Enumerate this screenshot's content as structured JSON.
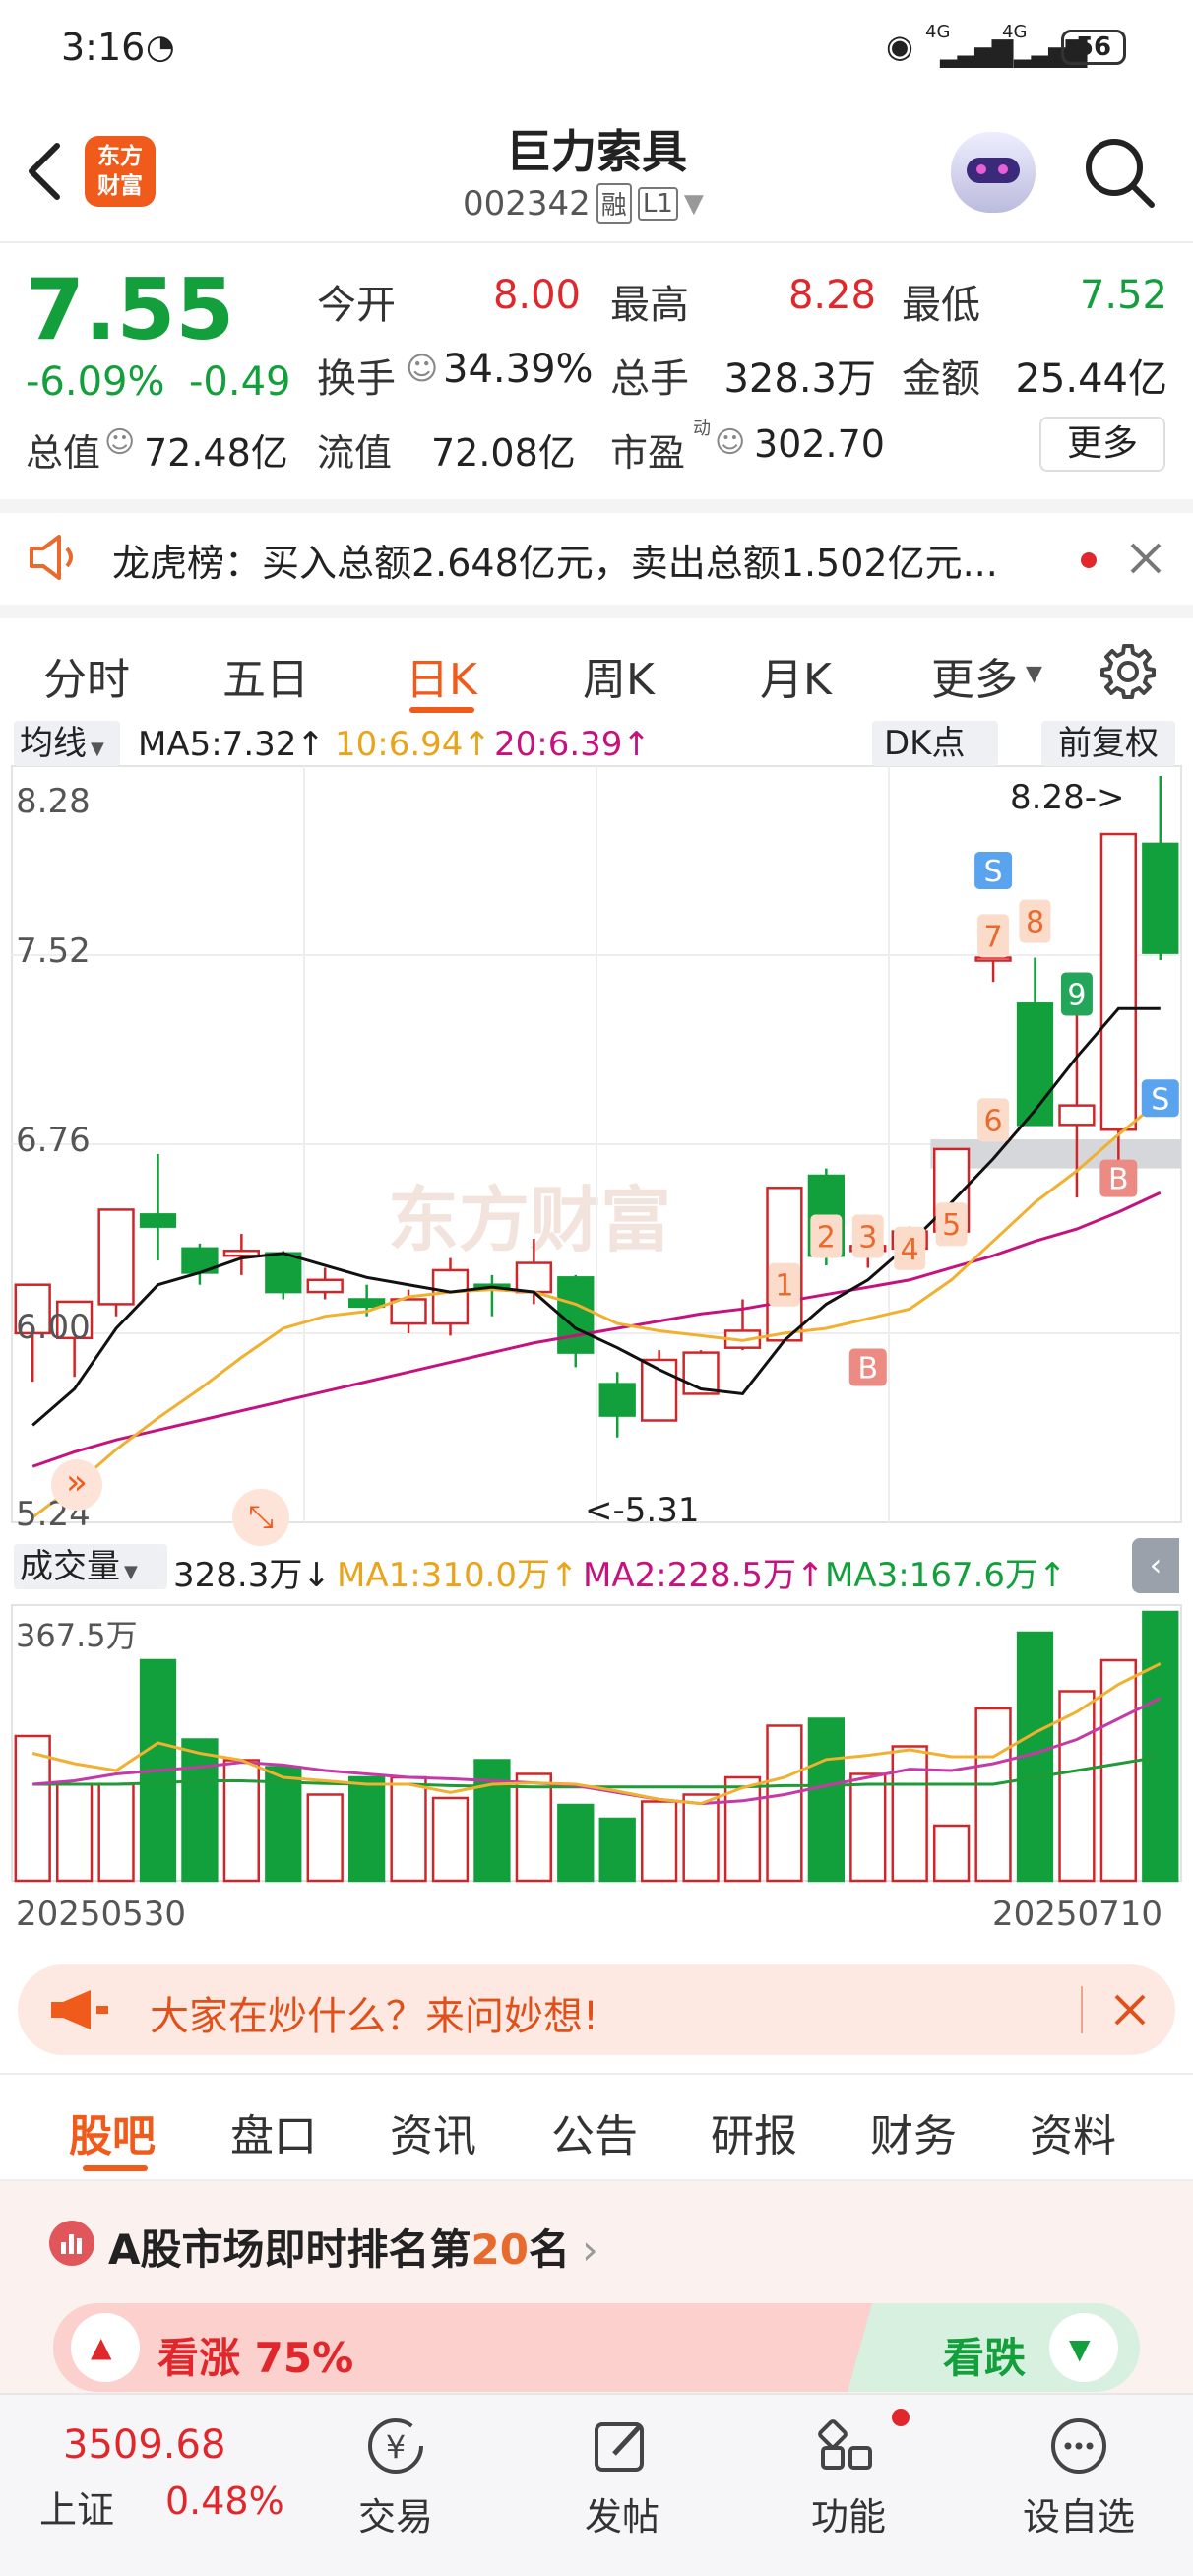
{
  "status": {
    "time": "3:16",
    "battery": "56",
    "net1": "4G",
    "net2": "4G"
  },
  "header": {
    "title": "巨力索具",
    "code": "002342",
    "tag1": "融",
    "tag2": "L1",
    "logo_line1": "东方",
    "logo_line2": "财富"
  },
  "quote": {
    "price": "7.55",
    "change_pct": "-6.09%",
    "change": "-0.49",
    "open_label": "今开",
    "open": "8.00",
    "high_label": "最高",
    "high": "8.28",
    "low_label": "最低",
    "low": "7.52",
    "turnover_label": "换手",
    "turnover": "34.39%",
    "volume_label": "总手",
    "volume": "328.3万",
    "amount_label": "金额",
    "amount": "25.44亿",
    "mktcap_label": "总值",
    "mktcap": "72.48亿",
    "float_label": "流值",
    "float": "72.08亿",
    "pe_label": "市盈",
    "pe_sup": "动",
    "pe": "302.70",
    "more": "更多"
  },
  "notice": {
    "text": "龙虎榜：买入总额2.648亿元，卖出总额1.502亿元..."
  },
  "tabs": [
    "分时",
    "五日",
    "日K",
    "周K",
    "月K",
    "更多"
  ],
  "active_tab": "日K",
  "ma_bar": {
    "select": "均线",
    "ma5": "MA5:7.32↑",
    "ma10": "10:6.94↑",
    "ma20": "20:6.39↑",
    "dk": "DK点",
    "adj": "前复权"
  },
  "price_axis": [
    "8.28",
    "7.52",
    "6.76",
    "6.00",
    "5.24"
  ],
  "annotations": {
    "high": "8.28->",
    "low": "<-5.31",
    "watermark": "东方财富"
  },
  "vol_bar": {
    "select": "成交量",
    "vol": "328.3万↓",
    "ma1": "MA1:310.0万↑",
    "ma2": "MA2:228.5万↑",
    "ma3": "MA3:167.6万↑",
    "max": "367.5万"
  },
  "date_range": {
    "start": "20250530",
    "end": "20250710"
  },
  "chart_data": {
    "type": "candlestick",
    "ylim": [
      5.24,
      8.28
    ],
    "candles": [
      {
        "o": 5.98,
        "c": 6.18,
        "h": 6.18,
        "l": 5.78
      },
      {
        "o": 5.96,
        "c": 6.11,
        "h": 6.11,
        "l": 5.8
      },
      {
        "o": 6.1,
        "c": 6.49,
        "h": 6.49,
        "l": 6.05
      },
      {
        "o": 6.47,
        "c": 6.42,
        "h": 6.72,
        "l": 6.28
      },
      {
        "o": 6.33,
        "c": 6.23,
        "h": 6.35,
        "l": 6.18
      },
      {
        "o": 6.3,
        "c": 6.32,
        "h": 6.39,
        "l": 6.22
      },
      {
        "o": 6.31,
        "c": 6.15,
        "h": 6.32,
        "l": 6.12
      },
      {
        "o": 6.15,
        "c": 6.2,
        "h": 6.25,
        "l": 6.12
      },
      {
        "o": 6.12,
        "c": 6.09,
        "h": 6.18,
        "l": 6.05
      },
      {
        "o": 6.02,
        "c": 6.12,
        "h": 6.16,
        "l": 5.98
      },
      {
        "o": 6.02,
        "c": 6.24,
        "h": 6.29,
        "l": 5.97
      },
      {
        "o": 6.18,
        "c": 6.16,
        "h": 6.22,
        "l": 6.05
      },
      {
        "o": 6.15,
        "c": 6.27,
        "h": 6.37,
        "l": 6.1
      },
      {
        "o": 6.21,
        "c": 5.9,
        "h": 6.22,
        "l": 5.84
      },
      {
        "o": 5.77,
        "c": 5.64,
        "h": 5.82,
        "l": 5.55
      },
      {
        "o": 5.62,
        "c": 5.87,
        "h": 5.91,
        "l": 5.62
      },
      {
        "o": 5.73,
        "c": 5.9,
        "h": 5.91,
        "l": 5.73
      },
      {
        "o": 5.92,
        "c": 5.99,
        "h": 6.12,
        "l": 5.91
      },
      {
        "o": 5.95,
        "c": 6.58,
        "h": 6.58,
        "l": 5.95
      },
      {
        "o": 6.63,
        "c": 6.3,
        "h": 6.66,
        "l": 6.26
      },
      {
        "o": 6.32,
        "c": 6.34,
        "h": 6.38,
        "l": 6.25
      },
      {
        "o": 6.33,
        "c": 6.4,
        "h": 6.42,
        "l": 6.33
      },
      {
        "o": 6.4,
        "c": 6.74,
        "h": 6.74,
        "l": 6.4
      },
      {
        "o": 7.52,
        "c": 7.53,
        "h": 7.66,
        "l": 7.43
      },
      {
        "o": 7.34,
        "c": 6.84,
        "h": 7.53,
        "l": 6.84
      },
      {
        "o": 6.84,
        "c": 6.92,
        "h": 7.34,
        "l": 6.54
      },
      {
        "o": 6.82,
        "c": 8.04,
        "h": 8.04,
        "l": 6.66
      },
      {
        "o": 8.0,
        "c": 7.55,
        "h": 8.28,
        "l": 7.52
      }
    ],
    "ma5": [
      5.6,
      5.75,
      6.0,
      6.18,
      6.23,
      6.29,
      6.31,
      6.26,
      6.21,
      6.18,
      6.15,
      6.17,
      6.15,
      6.0,
      5.92,
      5.83,
      5.75,
      5.73,
      5.95,
      6.1,
      6.2,
      6.35,
      6.52,
      6.7,
      6.9,
      7.12,
      7.32,
      7.32
    ],
    "ma10": [
      5.22,
      5.35,
      5.5,
      5.63,
      5.75,
      5.88,
      6.0,
      6.05,
      6.07,
      6.13,
      6.15,
      6.16,
      6.15,
      6.1,
      6.02,
      5.99,
      5.97,
      5.95,
      5.98,
      6.0,
      6.04,
      6.08,
      6.2,
      6.36,
      6.52,
      6.65,
      6.8,
      6.94
    ],
    "ma20": [
      5.43,
      5.49,
      5.54,
      5.58,
      5.62,
      5.66,
      5.7,
      5.74,
      5.78,
      5.82,
      5.86,
      5.9,
      5.94,
      5.97,
      6.0,
      6.03,
      6.06,
      6.08,
      6.11,
      6.14,
      6.17,
      6.2,
      6.25,
      6.3,
      6.36,
      6.41,
      6.48,
      6.56
    ],
    "volumes": [
      210,
      140,
      140,
      320,
      205,
      175,
      165,
      125,
      150,
      150,
      120,
      175,
      155,
      110,
      90,
      115,
      125,
      150,
      225,
      235,
      155,
      195,
      80,
      250,
      360,
      275,
      320,
      390
    ],
    "vol_ylim": [
      0,
      400
    ],
    "vol_ma1": [
      185,
      170,
      160,
      200,
      185,
      175,
      150,
      145,
      140,
      140,
      128,
      140,
      142,
      140,
      130,
      118,
      112,
      135,
      150,
      176,
      182,
      190,
      180,
      180,
      215,
      245,
      285,
      315
    ],
    "vol_ma2": [
      140,
      145,
      155,
      160,
      165,
      172,
      168,
      160,
      155,
      150,
      148,
      145,
      142,
      138,
      128,
      118,
      112,
      116,
      125,
      138,
      150,
      162,
      160,
      170,
      185,
      205,
      235,
      265
    ],
    "vol_ma3": [
      140,
      140,
      140,
      142,
      145,
      145,
      143,
      141,
      140,
      140,
      138,
      137,
      136,
      136,
      136,
      136,
      136,
      136,
      138,
      138,
      140,
      140,
      140,
      140,
      150,
      160,
      170,
      180
    ],
    "signals": [
      {
        "i": 18,
        "label": "1",
        "kind": "num"
      },
      {
        "i": 19,
        "label": "2",
        "kind": "num"
      },
      {
        "i": 20,
        "label": "3",
        "kind": "num"
      },
      {
        "i": 21,
        "label": "4",
        "kind": "num"
      },
      {
        "i": 22,
        "label": "5",
        "kind": "num"
      },
      {
        "i": 23,
        "label": "6",
        "kind": "num"
      },
      {
        "i": 23,
        "label": "7",
        "kind": "num"
      },
      {
        "i": 24,
        "label": "8",
        "kind": "num"
      },
      {
        "i": 25,
        "label": "9",
        "kind": "gnum"
      },
      {
        "i": 20,
        "label": "B",
        "kind": "buy"
      },
      {
        "i": 26,
        "label": "B",
        "kind": "buy"
      },
      {
        "i": 23,
        "label": "S",
        "kind": "sell"
      },
      {
        "i": 27,
        "label": "S",
        "kind": "sell"
      }
    ]
  },
  "banner": {
    "text": "大家在炒什么？来问妙想!"
  },
  "subtabs": [
    "股吧",
    "盘口",
    "资讯",
    "公告",
    "研报",
    "财务",
    "资料"
  ],
  "active_subtab": "股吧",
  "rank": {
    "prefix": "A股市场即时排名第",
    "num": "20",
    "suffix": "名",
    "bull_label": "看涨 75%",
    "bear_label": "看跌"
  },
  "bottom": {
    "index_value": "3509.68",
    "index_name": "上证",
    "index_pct": "0.48%",
    "items": [
      "交易",
      "发帖",
      "功能",
      "设自选"
    ]
  }
}
